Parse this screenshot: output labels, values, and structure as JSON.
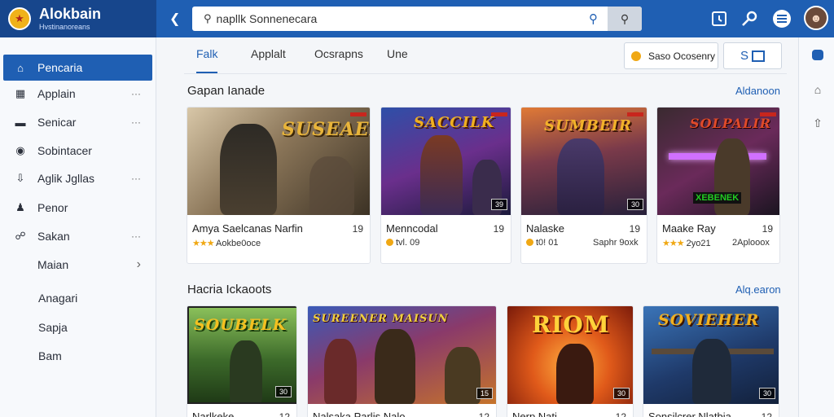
{
  "app": {
    "name": "Alokbain",
    "subtitle": "Hvstinanoreans",
    "logo_glyph": "★"
  },
  "search": {
    "value": "napllk Sonnenecara",
    "search_icon": "search-icon",
    "button_icon": "search-icon"
  },
  "topbar_icons": [
    "calendar-icon",
    "key-icon",
    "menu-icon",
    "avatar"
  ],
  "sidebar": {
    "items": [
      {
        "label": "Pencaria",
        "icon": "home-icon",
        "active": true,
        "more": ""
      },
      {
        "label": "Applain",
        "icon": "grid-icon",
        "active": false,
        "more": "···"
      },
      {
        "label": "Senicar",
        "icon": "list-icon",
        "active": false,
        "more": "···"
      },
      {
        "label": "Sobintacer",
        "icon": "controller-icon",
        "active": false,
        "more": ""
      },
      {
        "label": "Aglik Jgllas",
        "icon": "download-icon",
        "active": false,
        "more": "···"
      },
      {
        "label": "Penor",
        "icon": "users-icon",
        "active": false,
        "more": ""
      },
      {
        "label": "Sakan",
        "icon": "lock-icon",
        "active": false,
        "more": "···"
      },
      {
        "label": "Maian",
        "icon": "",
        "active": false,
        "more": "›"
      }
    ],
    "plain": [
      "Anagari",
      "Sapja",
      "Bam"
    ]
  },
  "tabs": [
    "Falk",
    "Applalt",
    "Ocsrapns",
    "Une"
  ],
  "header_buttons": {
    "sort": {
      "label": "Saso Ocosenry"
    },
    "view": {
      "label": "S"
    }
  },
  "sections": [
    {
      "title": "Gapan Ianade",
      "see_all": "Aldanoon",
      "cards": [
        {
          "name": "Amya Saelcanas Narfin",
          "num": "19",
          "rating": "★★★",
          "meta": "Aokbe0oce",
          "art": "SUSEAER",
          "badge": ""
        },
        {
          "name": "Menncodal",
          "num": "19",
          "rating": "dot",
          "meta": "tvl. 09",
          "art": "SACCILK",
          "badge": "39"
        },
        {
          "name": "Nalaske",
          "num": "19",
          "rating": "dot",
          "meta": "t0! 01",
          "meta2": "Saphr 9oxk",
          "art": "SUMBEIR",
          "badge": "30"
        },
        {
          "name": "Maake Ray",
          "num": "19",
          "rating": "★★★",
          "meta": "2yo21",
          "meta2": "2Aplooox",
          "art": "SOLPALIR",
          "badge": "XEBENEK"
        }
      ]
    },
    {
      "title": "Hacria Ickaoots",
      "see_all": "Alq.earon",
      "cards": [
        {
          "name": "Narlkeke",
          "num": "12",
          "art": "SOUBELK",
          "badge": "30"
        },
        {
          "name": "Nalsaka Parlis Nalo",
          "num": "12",
          "art": "SUREENER MAISUN",
          "badge": "15"
        },
        {
          "name": "Nerp Nati",
          "num": "12",
          "art": "RIOM",
          "badge": "30"
        },
        {
          "name": "Sonsilcrer Nlatbia",
          "num": "12",
          "art": "SOVIEHER",
          "badge": "30"
        }
      ]
    }
  ],
  "colors": {
    "topbar": "#1f5fb3",
    "brand_bar": "#17468c",
    "accent": "#1f5fb3",
    "star": "#f0a814"
  }
}
